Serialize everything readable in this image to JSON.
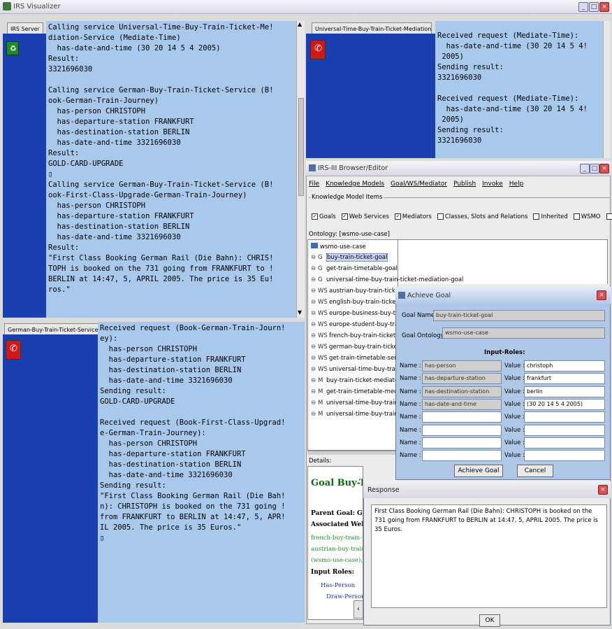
{
  "main_window": {
    "title": "IRS Visualizer",
    "server_tab": "IRS Server",
    "log_lines": [
      "Calling service Universal-Time-Buy-Train-Ticket-Me!",
      "diation-Service (Mediate-Time)",
      "  has-date-and-time (30 20 14 5 4 2005)",
      "Result:",
      "3321696030",
      "",
      "Calling service German-Buy-Train-Ticket-Service (B!",
      "ook-German-Train-Journey)",
      "  has-person CHRISTOPH",
      "  has-departure-station FRANKFURT",
      "  has-destination-station BERLIN",
      "  has-date-and-time 3321696030",
      "Result:",
      "GOLD-CARD-UPGRADE",
      "▯",
      "Calling service German-Buy-Train-Ticket-Service (B!",
      "ook-First-Class-Upgrade-German-Train-Journey)",
      "  has-person CHRISTOPH",
      "  has-departure-station FRANKFURT",
      "  has-destination-station BERLIN",
      "  has-date-and-time 3321696030",
      "Result:",
      "\"First Class Booking German Rail (Die Bahn): CHRIS!",
      "TOPH is booked on the 731 going from FRANKFURT to !",
      "BERLIN at 14:47, 5, APRIL 2005. The price is 35 Eu!",
      "ros.\""
    ]
  },
  "universal_panel": {
    "tab": "Universal-Time-Buy-Train-Ticket-Mediation-Service",
    "log_lines": [
      "Received request (Mediate-Time):",
      "  has-date-and-time (30 20 14 5 4!",
      " 2005)",
      "Sending result:",
      "3321696030",
      "",
      "Received request (Mediate-Time):",
      "  has-date-and-time (30 20 14 5 4!",
      " 2005)",
      "Sending result:",
      "3321696030"
    ]
  },
  "german_panel": {
    "tab": "German-Buy-Train-Ticket-Service",
    "log_lines": [
      "Received request (Book-German-Train-Journ!",
      "ey):",
      "  has-person CHRISTOPH",
      "  has-departure-station FRANKFURT",
      "  has-destination-station BERLIN",
      "  has-date-and-time 3321696030",
      "Sending result:",
      "GOLD-CARD-UPGRADE",
      "",
      "Received request (Book-First-Class-Upgrad!",
      "e-German-Train-Journey):",
      "  has-person CHRISTOPH",
      "  has-departure-station FRANKFURT",
      "  has-destination-station BERLIN",
      "  has-date-and-time 3321696030",
      "Sending result:",
      "\"First Class Booking German Rail (Die Bah!",
      "n): CHRISTOPH is booked on the 731 going !",
      "from FRANKFURT to BERLIN at 14:47, 5, APR!",
      "IL 2005. The price is 35 Euros.\"",
      "▯"
    ]
  },
  "browser": {
    "title": "IRS-III Browser/Editor",
    "menu": [
      "File",
      "Knowledge Models",
      "Goal/WS/Mediator",
      "Publish",
      "Invoke",
      "Help"
    ],
    "items_group": "Knowledge Model Items",
    "checkboxes": [
      {
        "label": "Goals",
        "checked": true
      },
      {
        "label": "Web Services",
        "checked": true
      },
      {
        "label": "Mediators",
        "checked": true
      },
      {
        "label": "Classes, Slots and Relations",
        "checked": false
      },
      {
        "label": "Inherited",
        "checked": false
      },
      {
        "label": "WSMO",
        "checked": false
      },
      {
        "label": "Bas",
        "checked": false
      }
    ],
    "ontology_label": "Ontology: [wsmo-use-case]",
    "tree_root": "wsmo-use-case",
    "tree": [
      {
        "type": "G",
        "label": "buy-train-ticket-goal",
        "selected": true
      },
      {
        "type": "G",
        "label": "get-train-timetable-goal"
      },
      {
        "type": "G",
        "label": "universal-time-buy-train-ticket-mediation-goal"
      },
      {
        "type": "WS",
        "label": "austrian-buy-train-ticket-s"
      },
      {
        "type": "WS",
        "label": "english-buy-train-ticket-se"
      },
      {
        "type": "WS",
        "label": "europe-business-buy-trai"
      },
      {
        "type": "WS",
        "label": "europe-student-buy-train-"
      },
      {
        "type": "WS",
        "label": "french-buy-train-ticket-ser"
      },
      {
        "type": "WS",
        "label": "german-buy-train-ticket-s"
      },
      {
        "type": "WS",
        "label": "get-train-timetable-servic"
      },
      {
        "type": "WS",
        "label": "universal-time-buy-train-ti"
      },
      {
        "type": "M",
        "label": "buy-train-ticket-mediator"
      },
      {
        "type": "M",
        "label": "get-train-timetable-media"
      },
      {
        "type": "M",
        "label": "universal-time-buy-train-ti"
      },
      {
        "type": "M",
        "label": "universal-time-buy-train-ti"
      }
    ],
    "details_label": "Details:",
    "details_heading": "Goal Buy-Trai",
    "details_parent": "Parent Goal: Goal",
    "details_assoc": "Associated Web Se",
    "details_links": [
      "french-buy-train-tic",
      "austrian-buy-train-ti",
      "(wsmo-use-case), e"
    ],
    "details_input_roles": "Input Roles:",
    "details_roles": [
      "Has-Person",
      "Draw-Person"
    ]
  },
  "achieve_goal": {
    "title": "Achieve Goal",
    "goal_name_label": "Goal Name:",
    "goal_name": "buy-train-ticket-goal",
    "goal_ontology_label": "Goal Ontology:",
    "goal_ontology": "wsmo-use-case",
    "input_roles_label": "Input-Roles:",
    "name_label": "Name :",
    "value_label": "Value :",
    "roles": [
      {
        "name": "has-person",
        "value": "christoph"
      },
      {
        "name": "has-departure-station",
        "value": "frankfurt"
      },
      {
        "name": "has-destination-station",
        "value": "berlin"
      },
      {
        "name": "has-date-and-time",
        "value": "(30 20 14 5 4 2005)"
      },
      {
        "name": "",
        "value": ""
      },
      {
        "name": "",
        "value": ""
      },
      {
        "name": "",
        "value": ""
      },
      {
        "name": "",
        "value": ""
      }
    ],
    "achieve_button": "Achieve Goal",
    "cancel_button": "Cancel"
  },
  "response": {
    "title": "Response",
    "text": "First Class Booking German Rail (Die Bahn): CHRISTOPH is booked on the 731 going from FRANKFURT to BERLIN at 14:47, 5, APRIL 2005. The price is 35 Euros.",
    "ok_button": "OK"
  },
  "colors": {
    "log_bg": "#a8c8ec",
    "sidebar_blue": "#1a3fb0",
    "title_bar": "#ece9d8",
    "dialog_bg": "#b0c8e8"
  }
}
